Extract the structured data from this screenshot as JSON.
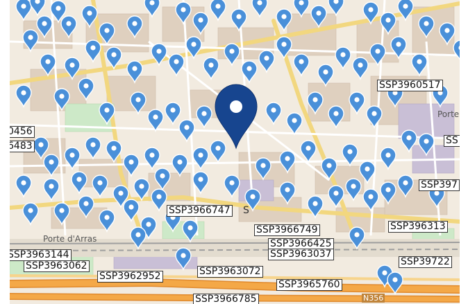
{
  "map": {
    "place_labels": [
      "Porte d'Arras",
      "Porte",
      "N356"
    ],
    "station_labels": [
      "SSP3960517",
      "SSP3966747",
      "SSP3966749",
      "SSP3966425",
      "SSP3963037",
      "SSP3963144",
      "SSP3963062",
      "SSP3962952",
      "SSP3963072",
      "SSP3965760",
      "SSP3966785",
      "SSP396313",
      "SSP39722",
      "SSP397",
      "SS",
      "0456",
      "6483",
      "S"
    ],
    "colors": {
      "marker": "#4a90d9",
      "marker_selected": "#17458f",
      "highway": "#f4a847",
      "primary_road": "#f7e08a",
      "park": "#cde9c8",
      "building": "#d9c9b8",
      "railway": "#9e9e9e"
    },
    "marker_icon": "map-pin-icon",
    "selected_marker_icon": "selected-map-pin-icon"
  }
}
